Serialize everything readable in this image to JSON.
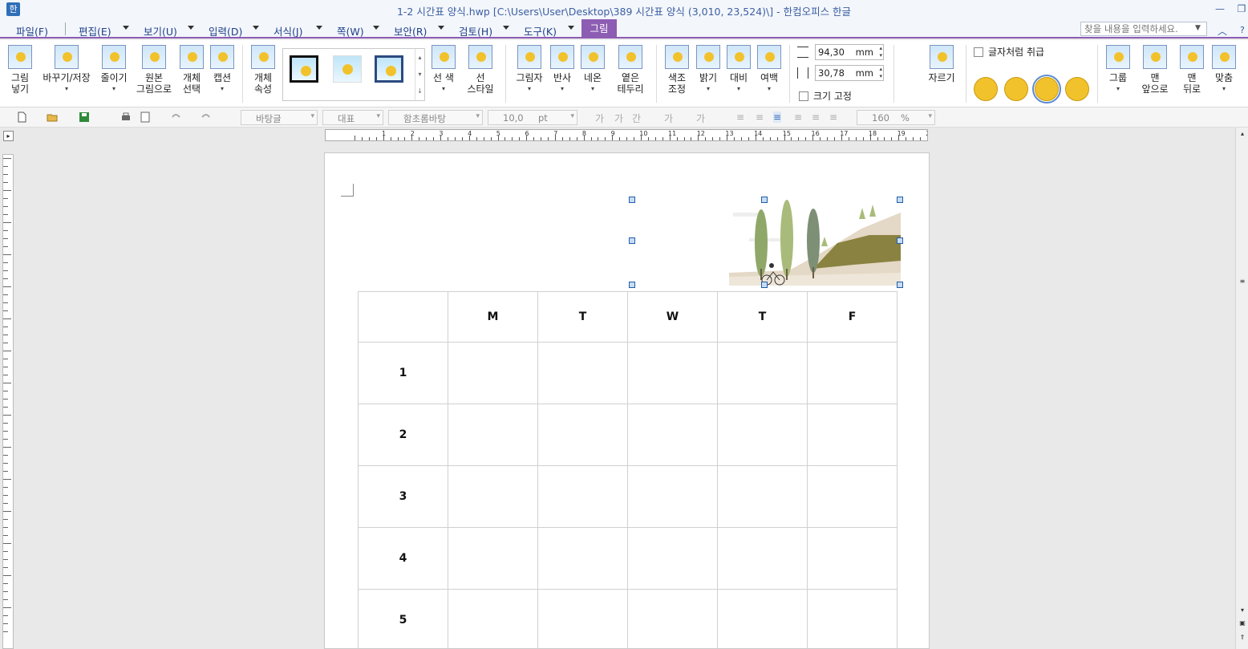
{
  "window": {
    "title": "1-2 시간표 양식.hwp [C:\\Users\\User\\Desktop\\389 시간표 양식 (3,010, 23,524)\\] - 한컴오피스 한글",
    "app_icon": "hwp-app-icon"
  },
  "menu": {
    "items": [
      {
        "label": "파일(F)"
      },
      {
        "label": "편집(E)"
      },
      {
        "label": "보기(U)"
      },
      {
        "label": "입력(D)"
      },
      {
        "label": "서식(J)"
      },
      {
        "label": "쪽(W)"
      },
      {
        "label": "보안(R)"
      },
      {
        "label": "검토(H)"
      },
      {
        "label": "도구(K)"
      }
    ],
    "active_tab": "그림",
    "search_placeholder": "찾을 내용을 입력하세요."
  },
  "ribbon": {
    "buttons": [
      {
        "label": "그림\n넣기",
        "icon": "insert-picture-icon"
      },
      {
        "label": "바꾸기/저장",
        "icon": "replace-save-icon"
      },
      {
        "label": "줄이기",
        "icon": "reduce-icon"
      },
      {
        "label": "원본\n그림으로",
        "icon": "original-picture-icon"
      },
      {
        "label": "개체\n선택",
        "icon": "object-select-icon"
      },
      {
        "label": "캡션",
        "icon": "caption-icon"
      },
      {
        "label": "개체\n속성",
        "icon": "object-properties-icon"
      },
      {
        "label": "선 색",
        "icon": "line-color-icon"
      },
      {
        "label": "선\n스타일",
        "icon": "line-style-icon"
      },
      {
        "label": "그림자",
        "icon": "shadow-icon"
      },
      {
        "label": "반사",
        "icon": "reflection-icon"
      },
      {
        "label": "네온",
        "icon": "neon-icon"
      },
      {
        "label": "옅은\n테두리",
        "icon": "soft-edge-icon"
      },
      {
        "label": "색조\n조정",
        "icon": "color-tone-icon"
      },
      {
        "label": "밝기",
        "icon": "brightness-icon"
      },
      {
        "label": "대비",
        "icon": "contrast-icon"
      },
      {
        "label": "여백",
        "icon": "margin-icon"
      },
      {
        "label": "자르기",
        "icon": "crop-icon"
      },
      {
        "label": "그룹",
        "icon": "group-icon"
      },
      {
        "label": "맨\n앞으로",
        "icon": "bring-to-front-icon"
      },
      {
        "label": "맨\n뒤로",
        "icon": "send-to-back-icon"
      },
      {
        "label": "맞춤",
        "icon": "align-icon"
      }
    ],
    "height_value": "94,30",
    "width_value": "30,78",
    "unit": "mm",
    "treat_as_char_label": "글자처럼 취급",
    "lock_size_label": "크기 고정"
  },
  "toolbar": {
    "style_combo": "바탕글",
    "font_lang_combo": "대표",
    "font_combo": "함초롬바탕",
    "font_size": "10,0",
    "font_unit": "pt",
    "char_buttons": [
      "가",
      "가",
      "간",
      "가",
      "가"
    ],
    "line_spacing": "160",
    "line_spacing_unit": "%"
  },
  "ruler": {
    "numbers": [
      "1",
      "2",
      "3",
      "4",
      "5",
      "6",
      "7",
      "8",
      "9",
      "10",
      "11",
      "12",
      "13",
      "14",
      "15",
      "16",
      "17",
      "18",
      "19",
      "20"
    ]
  },
  "timetable": {
    "days": [
      "M",
      "T",
      "W",
      "T",
      "F"
    ],
    "periods": [
      "1",
      "2",
      "3",
      "4",
      "5"
    ]
  },
  "colors": {
    "accent": "#8d5cb3",
    "title_text": "#3c5fa2",
    "handle": "#1f5ea8"
  }
}
